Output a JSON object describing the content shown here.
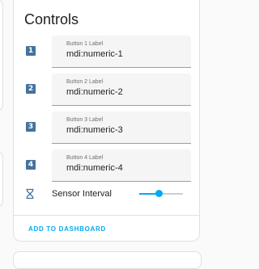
{
  "card": {
    "title": "Controls",
    "rows": [
      {
        "icon": "numeric-1-box-icon",
        "glyph": "1",
        "label": "Button 1 Label",
        "value": "mdi:numeric-1"
      },
      {
        "icon": "numeric-2-box-icon",
        "glyph": "2",
        "label": "Button 2 Label",
        "value": "mdi:numeric-2"
      },
      {
        "icon": "numeric-3-box-icon",
        "glyph": "3",
        "label": "Button 3 Label",
        "value": "mdi:numeric-3"
      },
      {
        "icon": "numeric-4-box-icon",
        "glyph": "4",
        "label": "Button 4 Label",
        "value": "mdi:numeric-4"
      }
    ],
    "sensor": {
      "icon": "hourglass-icon",
      "label": "Sensor Interval",
      "slider_fraction": 0.45
    },
    "action_label": "ADD TO DASHBOARD"
  },
  "colors": {
    "icon": "#44739e",
    "accent": "#03a9f4",
    "field_bg": "#f5f5f5"
  }
}
